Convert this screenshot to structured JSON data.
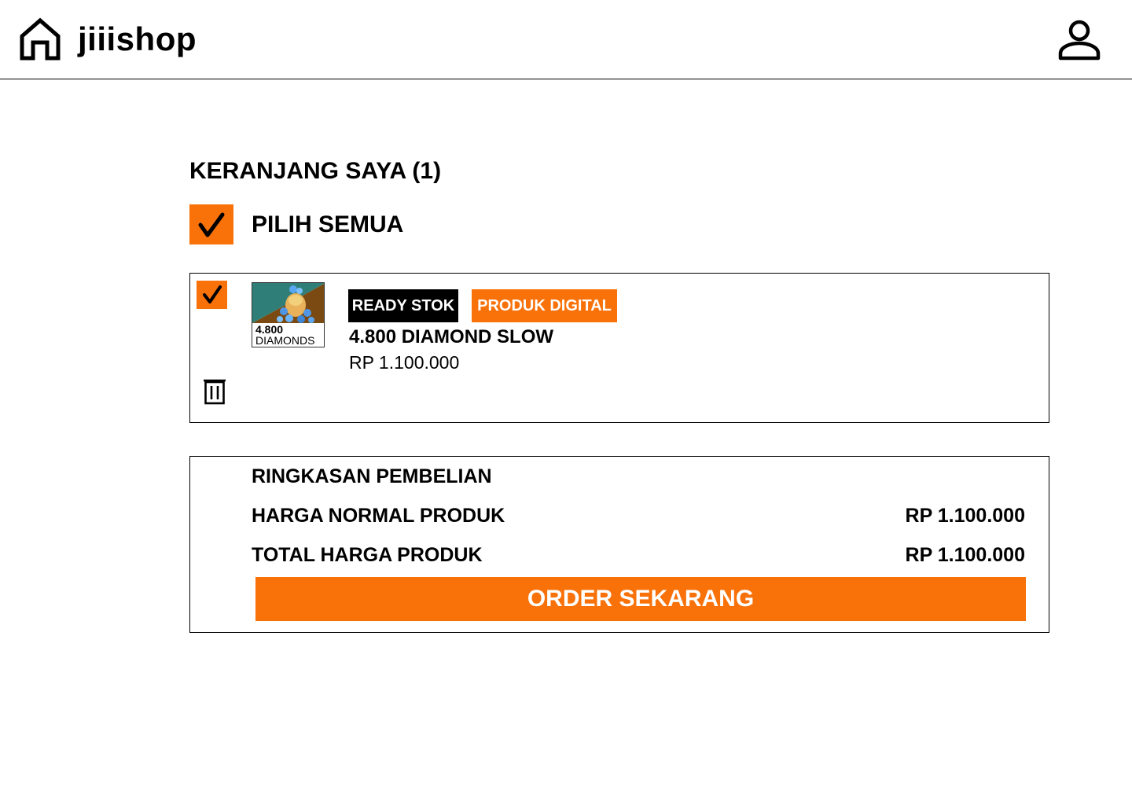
{
  "header": {
    "brand": "jiiishop",
    "home_icon": "home-icon",
    "profile_icon": "user-icon"
  },
  "cart": {
    "title": "KERANJANG SAYA (1)",
    "select_all_label": "PILIH SEMUA",
    "select_all_checked": true,
    "items": [
      {
        "checked": true,
        "thumbnail_qty": "4.800",
        "thumbnail_unit": "DIAMONDS",
        "badge_stock": "READY STOK",
        "badge_type": "PRODUK DIGITAL",
        "name": "4.800 DIAMOND SLOW",
        "price": "RP 1.100.000",
        "delete_icon": "trash-icon"
      }
    ]
  },
  "summary": {
    "title": "RINGKASAN PEMBELIAN",
    "normal_label": "HARGA NORMAL PRODUK",
    "normal_value": "RP 1.100.000",
    "total_label": "TOTAL HARGA PRODUK",
    "total_value": "RP 1.100.000",
    "order_button": "ORDER SEKARANG"
  },
  "colors": {
    "accent": "#f97109",
    "badge_dark": "#000000",
    "text": "#000000",
    "background": "#ffffff"
  }
}
